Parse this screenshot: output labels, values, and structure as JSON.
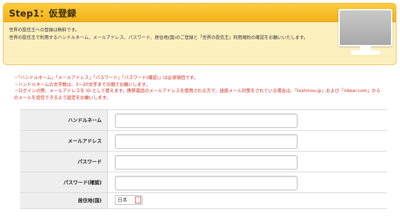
{
  "header": {
    "title": "Step1：仮登録",
    "description": [
      "世界の投信王への登録は無料です。",
      "世界の投信王で利用するハンドルネーム、メールアドレス、パスワード、居住地(国)のご登録と「世界の投信王」利用規約の確認をお願いいたします。"
    ],
    "illustration_icon": "monitor-icon"
  },
  "notes": [
    "・「ハンドルネーム」「メールアドレス」「パスワード」「パスワード(確認)」は必須項目です。",
    "・ハンドルネームの文字数は、3～20文字までの間でお願いします。",
    "・ログインの際、メールアドレスを ID として使えます。携帯電話のメールアドレスを使用される方で、迷惑メール対策をされている場合は、「toshinou.jp」および「nikkei.com」から",
    "のメールを受信できるよう設定をお願いします。"
  ],
  "form": {
    "fields": [
      {
        "label": "ハンドルネーム",
        "value": ""
      },
      {
        "label": "メールアドレス",
        "value": ""
      },
      {
        "label": "パスワード",
        "value": ""
      },
      {
        "label": "パスワード(確認)",
        "value": ""
      }
    ],
    "residence": {
      "label": "居住地(国)",
      "selected": "日本"
    }
  },
  "colors": {
    "header_bar": "#f3b21b",
    "header_panel": "#fdf0bf",
    "note_text": "#d4261b",
    "label_cell": "#eeeeee"
  }
}
